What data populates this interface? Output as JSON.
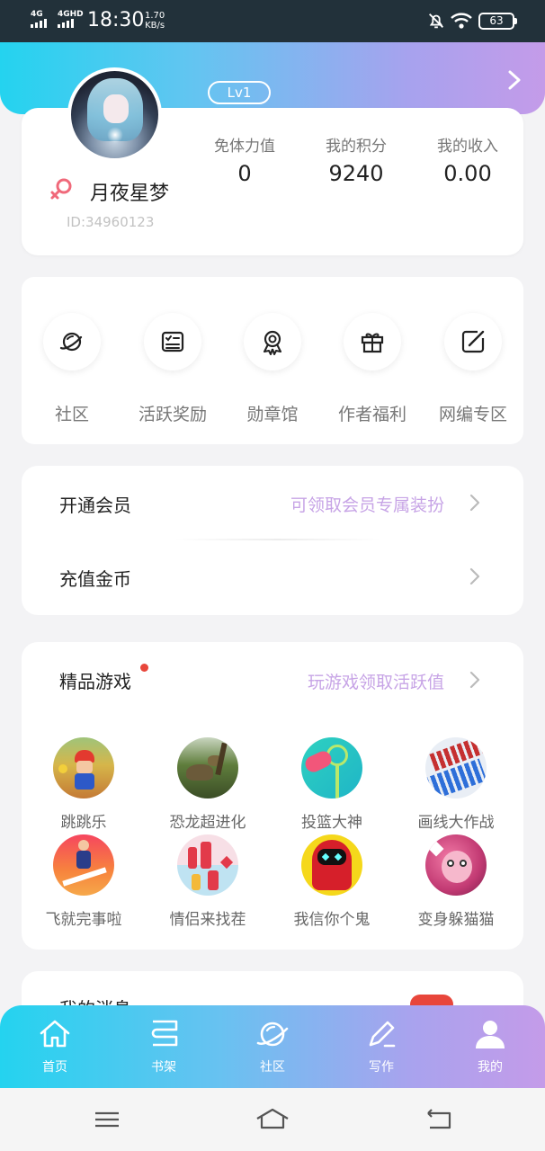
{
  "status_bar": {
    "signal_1": "4G",
    "signal_2": "4GHD",
    "time": "18:30",
    "speed_value": "1.70",
    "speed_unit": "KB/s",
    "battery": "63"
  },
  "header": {
    "level": "Lv1"
  },
  "profile": {
    "username": "月夜星梦",
    "user_id": "ID:34960123",
    "stats": [
      {
        "label": "免体力值",
        "value": "0"
      },
      {
        "label": "我的积分",
        "value": "9240"
      },
      {
        "label": "我的收入",
        "value": "0.00"
      }
    ]
  },
  "quick_menu": [
    {
      "label": "社区",
      "icon": "planet-icon"
    },
    {
      "label": "活跃奖励",
      "icon": "checklist-icon"
    },
    {
      "label": "勋章馆",
      "icon": "medal-icon"
    },
    {
      "label": "作者福利",
      "icon": "gift-icon"
    },
    {
      "label": "网编专区",
      "icon": "edit-icon"
    }
  ],
  "membership": {
    "vip_title": "开通会员",
    "vip_hint": "可领取会员专属装扮",
    "recharge_title": "充值金币"
  },
  "games": {
    "title": "精品游戏",
    "hint": "玩游戏领取活跃值",
    "items": [
      {
        "name": "跳跳乐"
      },
      {
        "name": "恐龙超进化"
      },
      {
        "name": "投篮大神"
      },
      {
        "name": "画线大作战"
      },
      {
        "name": "飞就完事啦"
      },
      {
        "name": "情侣来找茬"
      },
      {
        "name": "我信你个鬼"
      },
      {
        "name": "变身躲猫猫"
      }
    ]
  },
  "messages": {
    "title": "我的消息"
  },
  "bottom_nav": [
    {
      "label": "首页",
      "icon": "home-icon"
    },
    {
      "label": "书架",
      "icon": "bookshelf-icon"
    },
    {
      "label": "社区",
      "icon": "planet-icon"
    },
    {
      "label": "写作",
      "icon": "pen-icon"
    },
    {
      "label": "我的",
      "icon": "user-icon",
      "active": true
    }
  ],
  "colors": {
    "accent_cyan": "#24d3ef",
    "accent_purple": "#c49be9",
    "hint_purple": "#c7a4e6",
    "badge_red": "#e8463b"
  }
}
